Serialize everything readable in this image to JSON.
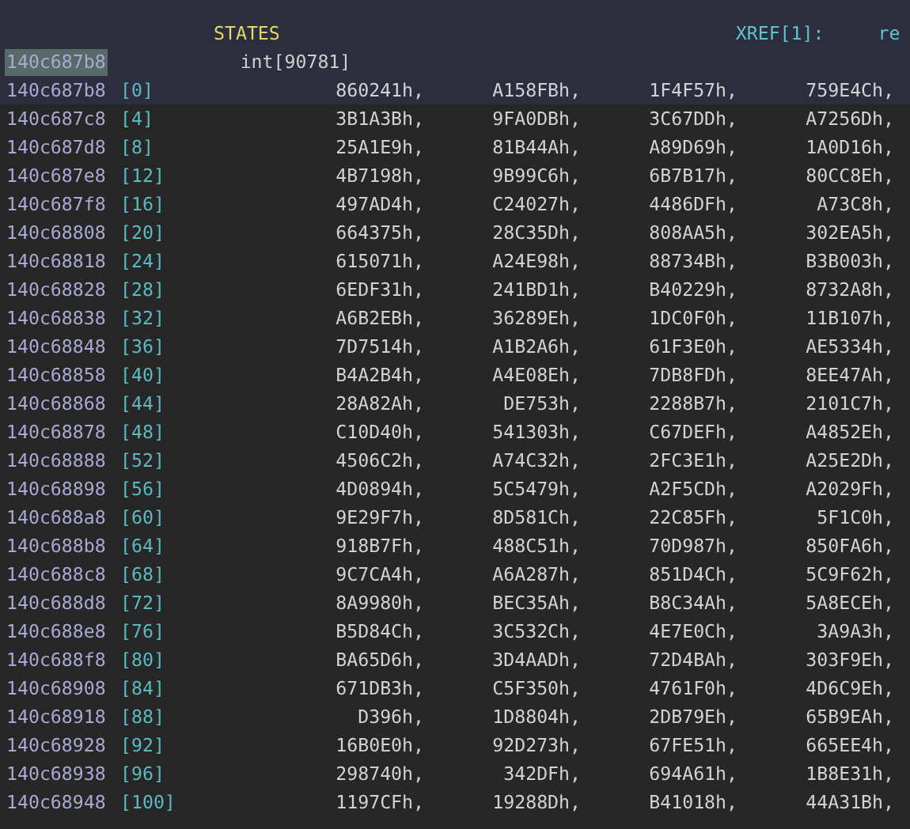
{
  "header": {
    "label": "STATES",
    "xref_label": "XREF[1]:",
    "xref_value": "re"
  },
  "data_type": {
    "address": "140c687b8",
    "cursor": true,
    "type": "int[90781]"
  },
  "rows": [
    {
      "address": "140c687b8",
      "index": "[0]",
      "values": [
        "860241h,",
        "A158FBh,",
        "1F4F57h,",
        "759E4Ch,"
      ],
      "selected": true
    },
    {
      "address": "140c687c8",
      "index": "[4]",
      "values": [
        "3B1A3Bh,",
        "9FA0DBh,",
        "3C67DDh,",
        "A7256Dh,"
      ],
      "selected": false
    },
    {
      "address": "140c687d8",
      "index": "[8]",
      "values": [
        "25A1E9h,",
        "81B44Ah,",
        "A89D69h,",
        "1A0D16h,"
      ],
      "selected": false
    },
    {
      "address": "140c687e8",
      "index": "[12]",
      "values": [
        "4B7198h,",
        "9B99C6h,",
        "6B7B17h,",
        "80CC8Eh,"
      ],
      "selected": false
    },
    {
      "address": "140c687f8",
      "index": "[16]",
      "values": [
        "497AD4h,",
        "C24027h,",
        "4486DFh,",
        "A73C8h,"
      ],
      "selected": false
    },
    {
      "address": "140c68808",
      "index": "[20]",
      "values": [
        "664375h,",
        "28C35Dh,",
        "808AA5h,",
        "302EA5h,"
      ],
      "selected": false
    },
    {
      "address": "140c68818",
      "index": "[24]",
      "values": [
        "615071h,",
        "A24E98h,",
        "88734Bh,",
        "B3B003h,"
      ],
      "selected": false
    },
    {
      "address": "140c68828",
      "index": "[28]",
      "values": [
        "6EDF31h,",
        "241BD1h,",
        "B40229h,",
        "8732A8h,"
      ],
      "selected": false
    },
    {
      "address": "140c68838",
      "index": "[32]",
      "values": [
        "A6B2EBh,",
        "36289Eh,",
        "1DC0F0h,",
        "11B107h,"
      ],
      "selected": false
    },
    {
      "address": "140c68848",
      "index": "[36]",
      "values": [
        "7D7514h,",
        "A1B2A6h,",
        "61F3E0h,",
        "AE5334h,"
      ],
      "selected": false
    },
    {
      "address": "140c68858",
      "index": "[40]",
      "values": [
        "B4A2B4h,",
        "A4E08Eh,",
        "7DB8FDh,",
        "8EE47Ah,"
      ],
      "selected": false
    },
    {
      "address": "140c68868",
      "index": "[44]",
      "values": [
        "28A82Ah,",
        "DE753h,",
        "2288B7h,",
        "2101C7h,"
      ],
      "selected": false
    },
    {
      "address": "140c68878",
      "index": "[48]",
      "values": [
        "C10D40h,",
        "541303h,",
        "C67DEFh,",
        "A4852Eh,"
      ],
      "selected": false
    },
    {
      "address": "140c68888",
      "index": "[52]",
      "values": [
        "4506C2h,",
        "A74C32h,",
        "2FC3E1h,",
        "A25E2Dh,"
      ],
      "selected": false
    },
    {
      "address": "140c68898",
      "index": "[56]",
      "values": [
        "4D0894h,",
        "5C5479h,",
        "A2F5CDh,",
        "A2029Fh,"
      ],
      "selected": false
    },
    {
      "address": "140c688a8",
      "index": "[60]",
      "values": [
        "9E29F7h,",
        "8D581Ch,",
        "22C85Fh,",
        "5F1C0h,"
      ],
      "selected": false
    },
    {
      "address": "140c688b8",
      "index": "[64]",
      "values": [
        "918B7Fh,",
        "488C51h,",
        "70D987h,",
        "850FA6h,"
      ],
      "selected": false
    },
    {
      "address": "140c688c8",
      "index": "[68]",
      "values": [
        "9C7CA4h,",
        "A6A287h,",
        "851D4Ch,",
        "5C9F62h,"
      ],
      "selected": false
    },
    {
      "address": "140c688d8",
      "index": "[72]",
      "values": [
        "8A9980h,",
        "BEC35Ah,",
        "B8C34Ah,",
        "5A8ECEh,"
      ],
      "selected": false
    },
    {
      "address": "140c688e8",
      "index": "[76]",
      "values": [
        "B5D84Ch,",
        "3C532Ch,",
        "4E7E0Ch,",
        "3A9A3h,"
      ],
      "selected": false
    },
    {
      "address": "140c688f8",
      "index": "[80]",
      "values": [
        "BA65D6h,",
        "3D4AADh,",
        "72D4BAh,",
        "303F9Eh,"
      ],
      "selected": false
    },
    {
      "address": "140c68908",
      "index": "[84]",
      "values": [
        "671DB3h,",
        "C5F350h,",
        "4761F0h,",
        "4D6C9Eh,"
      ],
      "selected": false
    },
    {
      "address": "140c68918",
      "index": "[88]",
      "values": [
        "D396h,",
        "1D8804h,",
        "2DB79Eh,",
        "65B9EAh,"
      ],
      "selected": false
    },
    {
      "address": "140c68928",
      "index": "[92]",
      "values": [
        "16B0E0h,",
        "92D273h,",
        "67FE51h,",
        "665EE4h,"
      ],
      "selected": false
    },
    {
      "address": "140c68938",
      "index": "[96]",
      "values": [
        "298740h,",
        "342DFh,",
        "694A61h,",
        "1B8E31h,"
      ],
      "selected": false
    },
    {
      "address": "140c68948",
      "index": "[100]",
      "values": [
        "1197CFh,",
        "19288Dh,",
        "B41018h,",
        "44A31Bh,"
      ],
      "selected": false
    }
  ]
}
